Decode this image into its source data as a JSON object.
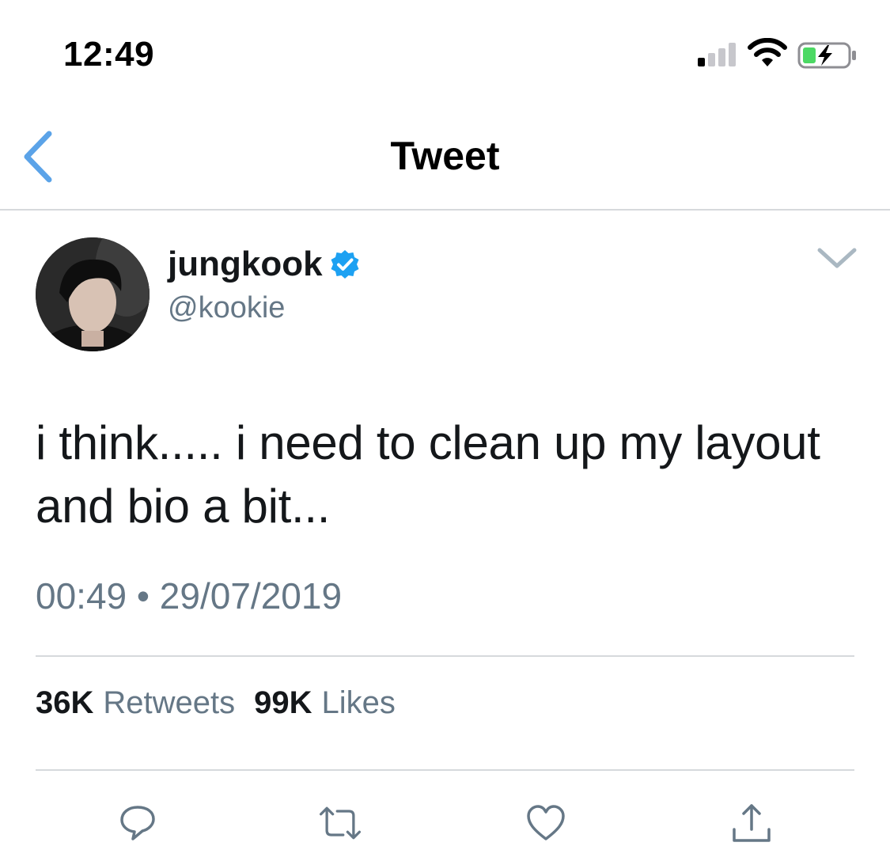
{
  "status_bar": {
    "time": "12:49"
  },
  "nav": {
    "title": "Tweet",
    "accent_color": "#5ba3e8"
  },
  "tweet": {
    "display_name": "jungkook",
    "handle": "@kookie",
    "verified": true,
    "text": "i think..... i need to clean up my layout and bio a bit...",
    "time": "00:49",
    "separator": "•",
    "date": "29/07/2019"
  },
  "stats": {
    "retweets_count": "36K",
    "retweets_label": "Retweets",
    "likes_count": "99K",
    "likes_label": "Likes"
  },
  "actions": [
    {
      "name": "reply",
      "icon": "reply-icon"
    },
    {
      "name": "retweet",
      "icon": "retweet-icon"
    },
    {
      "name": "like",
      "icon": "heart-icon"
    },
    {
      "name": "share",
      "icon": "share-icon"
    }
  ],
  "colors": {
    "text_primary": "#14171a",
    "text_secondary": "#657786",
    "divider": "#d6d9dc",
    "verified_blue": "#1da1f2",
    "battery_green": "#4cd964"
  }
}
